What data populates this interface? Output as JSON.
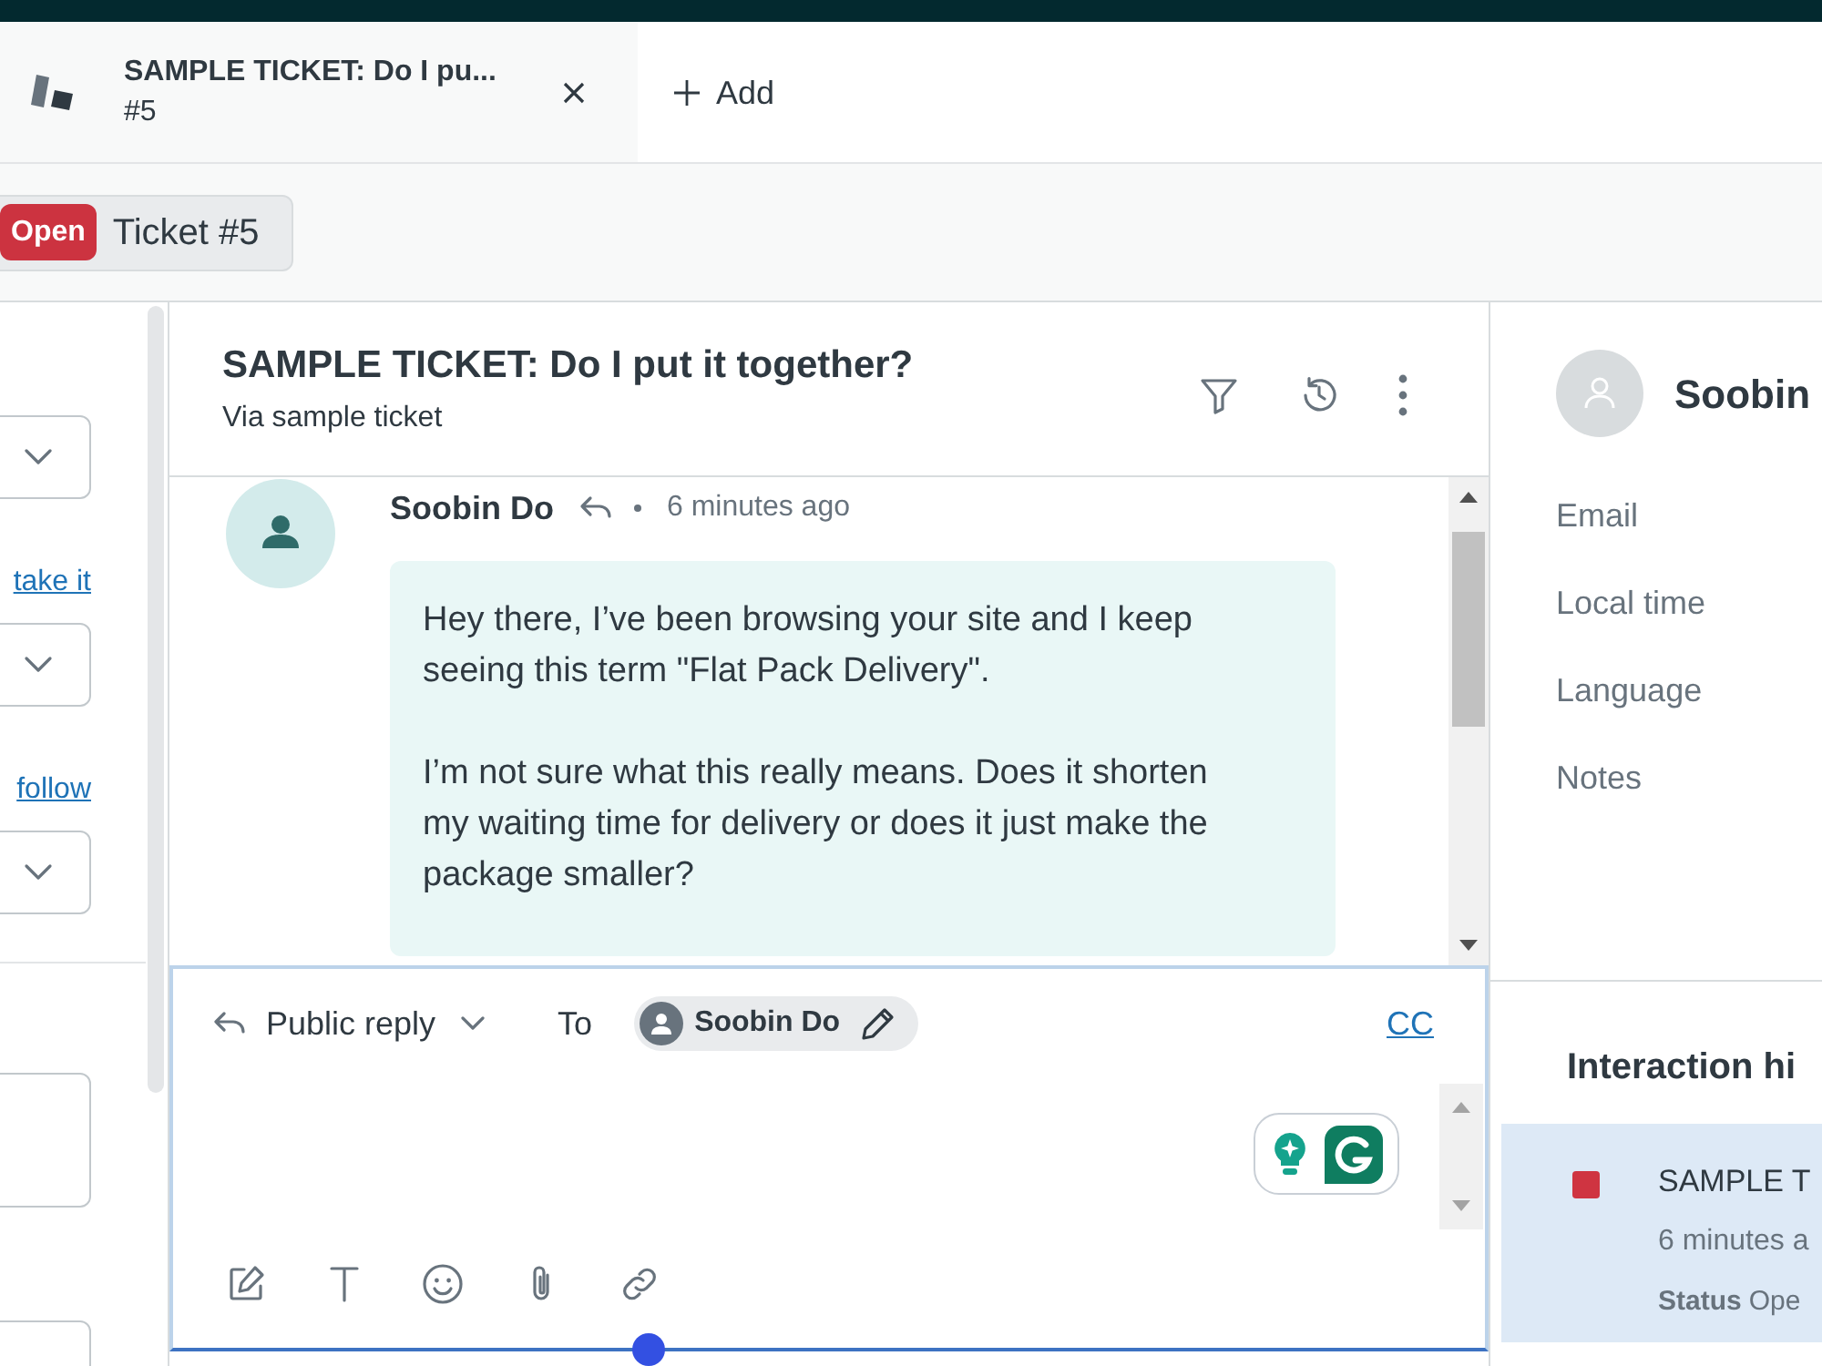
{
  "tabs": [
    {
      "title": "SAMPLE TICKET: Do I pu...",
      "number": "#5",
      "selected": true
    }
  ],
  "add_tab": {
    "label": "Add"
  },
  "ticket_bar": {
    "status": "Open",
    "label": "Ticket #5"
  },
  "properties_panel": {
    "items": [
      {
        "kind": "dropdown"
      },
      {
        "kind": "link",
        "text": "take it"
      },
      {
        "kind": "dropdown"
      },
      {
        "kind": "link",
        "text": "follow"
      },
      {
        "kind": "dropdown"
      },
      {
        "kind": "textarea"
      },
      {
        "kind": "input"
      }
    ]
  },
  "conversation": {
    "title": "SAMPLE TICKET: Do I put it together?",
    "channel": "Via sample ticket",
    "messages": [
      {
        "author": "Soobin Do",
        "time": "6 minutes ago",
        "paragraphs": [
          "Hey there, I’ve been browsing your site and I keep seeing this term \"Flat Pack Delivery\".",
          "I’m not sure what this really means. Does it shorten my waiting time for delivery or does it just make the package smaller?"
        ]
      }
    ]
  },
  "reply": {
    "mode": "Public reply",
    "to_label": "To",
    "recipients": [
      "Soobin Do"
    ],
    "cc": "CC"
  },
  "customer": {
    "name": "Soobin",
    "fields": [
      "Email",
      "Local time",
      "Language",
      "Notes"
    ]
  },
  "interaction_history": {
    "title": "Interaction hi",
    "items": [
      {
        "title": "SAMPLE T",
        "time": "6 minutes a",
        "status_label": "Status",
        "status": "Ope",
        "color": "#cf3441",
        "selected": true
      }
    ]
  }
}
